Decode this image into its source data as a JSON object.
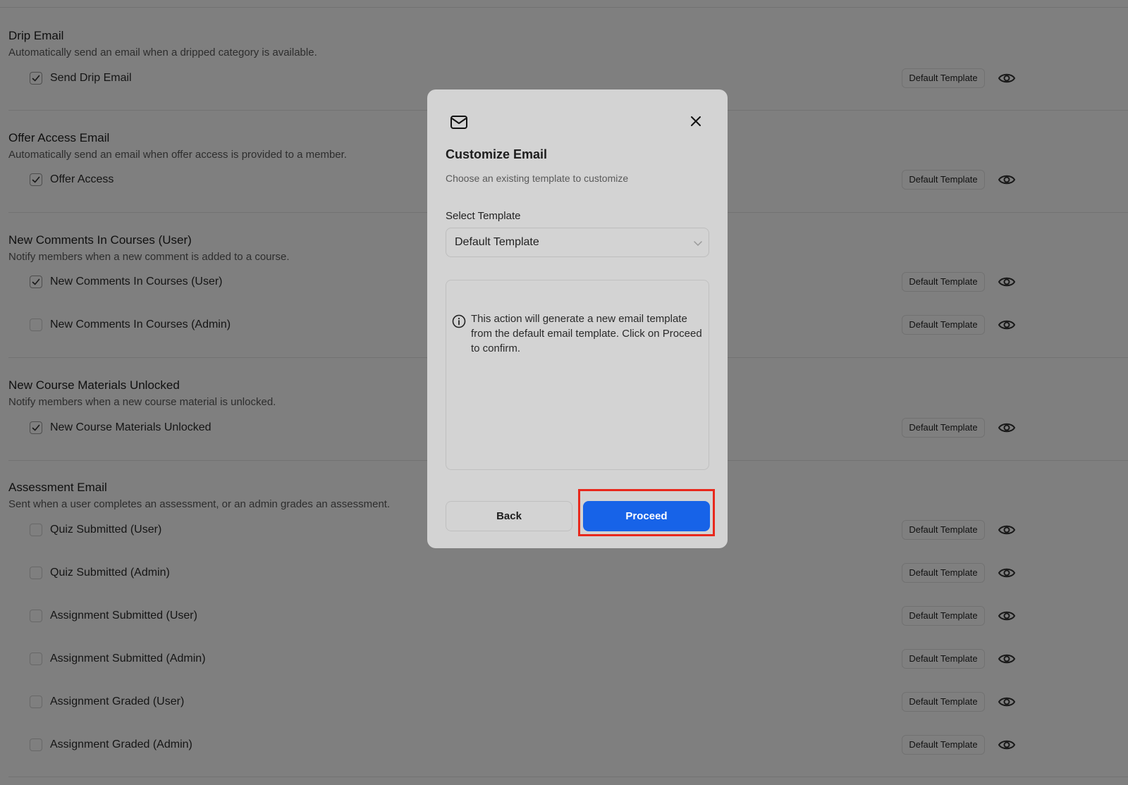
{
  "sections": [
    {
      "title": "Drip Email",
      "description": "Automatically send an email when a dripped category is available.",
      "rows": [
        {
          "label": "Send Drip Email",
          "checked": true,
          "template": "Default Template"
        }
      ]
    },
    {
      "title": "Offer Access Email",
      "description": "Automatically send an email when offer access is provided to a member.",
      "rows": [
        {
          "label": "Offer Access",
          "checked": true,
          "template": "Default Template"
        }
      ]
    },
    {
      "title": "New Comments In Courses (User)",
      "description": "Notify members when a new comment is added to a course.",
      "rows": [
        {
          "label": "New Comments In Courses (User)",
          "checked": true,
          "template": "Default Template"
        },
        {
          "label": "New Comments In Courses (Admin)",
          "checked": false,
          "template": "Default Template"
        }
      ]
    },
    {
      "title": "New Course Materials Unlocked",
      "description": "Notify members when a new course material is unlocked.",
      "rows": [
        {
          "label": "New Course Materials Unlocked",
          "checked": true,
          "template": "Default Template"
        }
      ]
    },
    {
      "title": "Assessment Email",
      "description": "Sent when a user completes an assessment, or an admin grades an assessment.",
      "rows": [
        {
          "label": "Quiz Submitted (User)",
          "checked": false,
          "template": "Default Template"
        },
        {
          "label": "Quiz Submitted (Admin)",
          "checked": false,
          "template": "Default Template"
        },
        {
          "label": "Assignment Submitted (User)",
          "checked": false,
          "template": "Default Template"
        },
        {
          "label": "Assignment Submitted (Admin)",
          "checked": false,
          "template": "Default Template"
        },
        {
          "label": "Assignment Graded (User)",
          "checked": false,
          "template": "Default Template"
        },
        {
          "label": "Assignment Graded (Admin)",
          "checked": false,
          "template": "Default Template"
        }
      ]
    }
  ],
  "modal": {
    "icon": "mail-icon",
    "title": "Customize Email",
    "subtitle": "Choose an existing template to customize",
    "select_label": "Select Template",
    "select_value": "Default Template",
    "info_text": "This action will generate a new email template from the default email template. Click on Proceed to confirm.",
    "back_label": "Back",
    "proceed_label": "Proceed"
  },
  "colors": {
    "primary": "#1763e8",
    "highlight": "#e8281c",
    "overlay": "rgba(0,0,0,0.5)"
  }
}
